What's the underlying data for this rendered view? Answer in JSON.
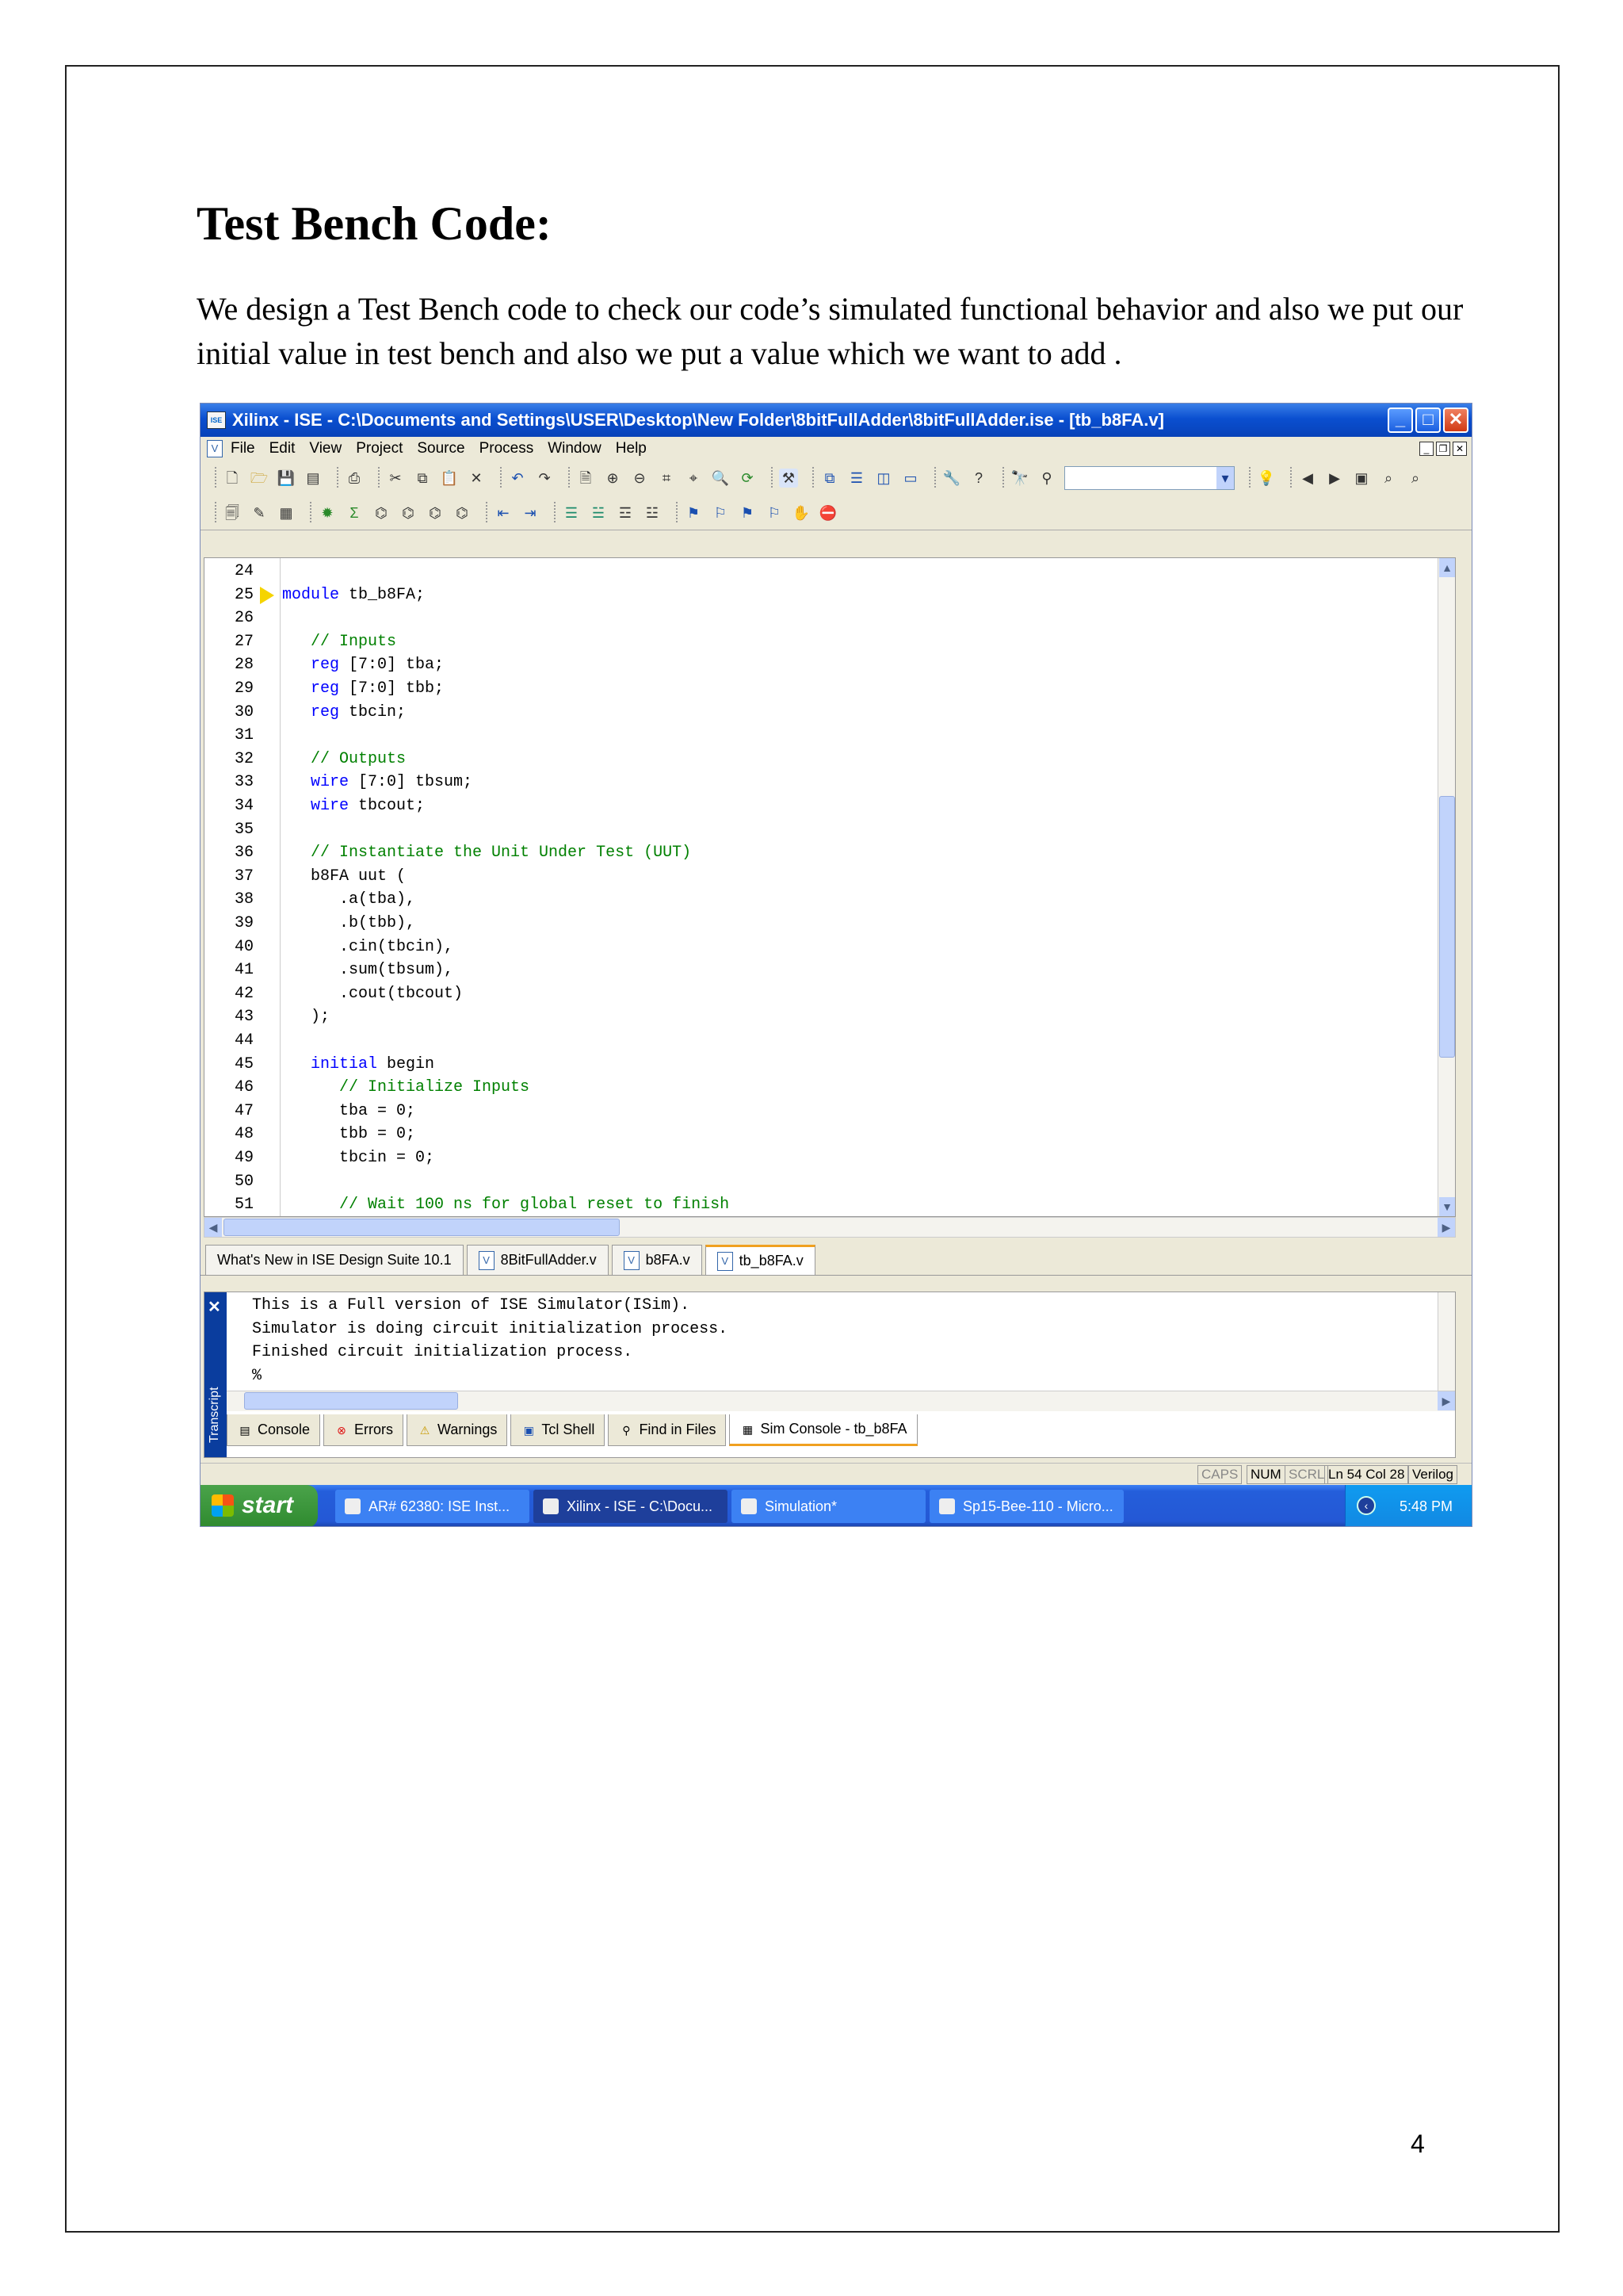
{
  "doc": {
    "heading": "Test Bench Code:",
    "paragraph": "We design a Test Bench code to check our code’s simulated functional behavior and also we put our initial value in test bench and also we put a value which we want to add .",
    "page_number": "4"
  },
  "window": {
    "title": "Xilinx - ISE - C:\\Documents and Settings\\USER\\Desktop\\New Folder\\8bitFullAdder\\8bitFullAdder.ise - [tb_b8FA.v]",
    "menu": [
      "File",
      "Edit",
      "View",
      "Project",
      "Source",
      "Process",
      "Window",
      "Help"
    ]
  },
  "editor": {
    "lines": [
      {
        "n": "24",
        "t": ""
      },
      {
        "n": "25",
        "t": "module tb_b8FA;"
      },
      {
        "n": "26",
        "t": ""
      },
      {
        "n": "27",
        "t": "   // Inputs"
      },
      {
        "n": "28",
        "t": "   reg [7:0] tba;"
      },
      {
        "n": "29",
        "t": "   reg [7:0] tbb;"
      },
      {
        "n": "30",
        "t": "   reg tbcin;"
      },
      {
        "n": "31",
        "t": ""
      },
      {
        "n": "32",
        "t": "   // Outputs"
      },
      {
        "n": "33",
        "t": "   wire [7:0] tbsum;"
      },
      {
        "n": "34",
        "t": "   wire tbcout;"
      },
      {
        "n": "35",
        "t": ""
      },
      {
        "n": "36",
        "t": "   // Instantiate the Unit Under Test (UUT)"
      },
      {
        "n": "37",
        "t": "   b8FA uut ("
      },
      {
        "n": "38",
        "t": "      .a(tba),"
      },
      {
        "n": "39",
        "t": "      .b(tbb),"
      },
      {
        "n": "40",
        "t": "      .cin(tbcin),"
      },
      {
        "n": "41",
        "t": "      .sum(tbsum),"
      },
      {
        "n": "42",
        "t": "      .cout(tbcout)"
      },
      {
        "n": "43",
        "t": "   );"
      },
      {
        "n": "44",
        "t": ""
      },
      {
        "n": "45",
        "t": "   initial begin"
      },
      {
        "n": "46",
        "t": "      // Initialize Inputs"
      },
      {
        "n": "47",
        "t": "      tba = 0;"
      },
      {
        "n": "48",
        "t": "      tbb = 0;"
      },
      {
        "n": "49",
        "t": "      tbcin = 0;"
      },
      {
        "n": "50",
        "t": ""
      },
      {
        "n": "51",
        "t": "      // Wait 100 ns for global reset to finish"
      }
    ]
  },
  "doc_tabs": [
    "What's New in ISE Design Suite 10.1",
    "8BitFullAdder.v",
    "b8FA.v",
    "tb_b8FA.v"
  ],
  "transcript": {
    "label": "Transcript",
    "lines": [
      "This is a Full version of ISE Simulator(ISim).",
      "Simulator is doing circuit initialization process.",
      "Finished circuit initialization process.",
      "%"
    ],
    "tabs": [
      "Console",
      "Errors",
      "Warnings",
      "Tcl Shell",
      "Find in Files",
      "Sim Console - tb_b8FA"
    ]
  },
  "status": {
    "caps": "CAPS",
    "num": "NUM",
    "scrl": "SCRL",
    "position": "Ln 54 Col 28",
    "language": "Verilog"
  },
  "taskbar": {
    "start": "start",
    "tasks": [
      "AR# 62380: ISE Inst...",
      "Xilinx - ISE - C:\\Docu...",
      "Simulation*",
      "Sp15-Bee-110 - Micro..."
    ],
    "clock": "5:48 PM"
  },
  "colors": {
    "keyword": "#0000ff",
    "comment": "#008000",
    "titlebar": "#0a4fd0",
    "taskbar": "#245edb",
    "active_tab_accent": "#f0a020"
  }
}
